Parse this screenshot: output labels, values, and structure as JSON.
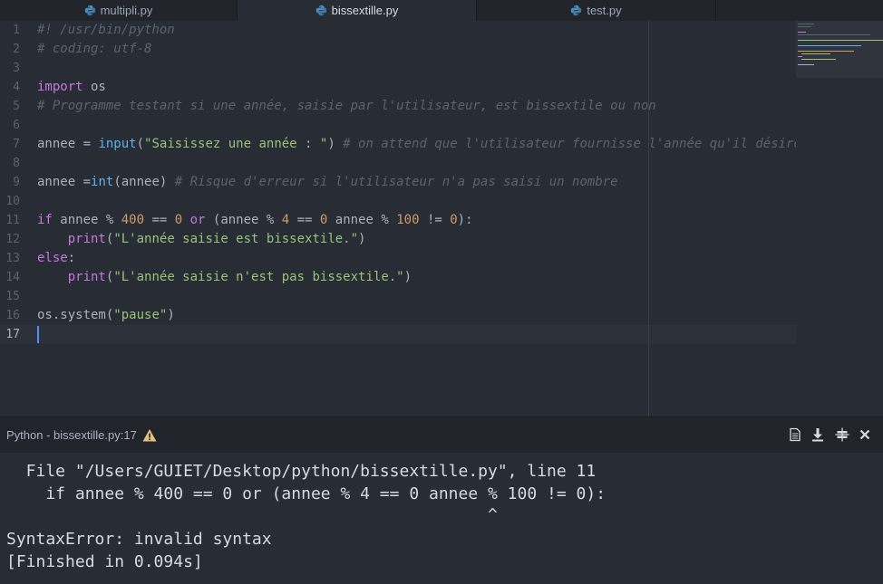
{
  "tabs": [
    {
      "label": "multipli.py",
      "active": false
    },
    {
      "label": "bissextille.py",
      "active": true
    },
    {
      "label": "test.py",
      "active": false
    }
  ],
  "editor": {
    "line_numbers": [
      "1",
      "2",
      "3",
      "4",
      "5",
      "6",
      "7",
      "8",
      "9",
      "10",
      "11",
      "12",
      "13",
      "14",
      "15",
      "16",
      "17"
    ],
    "current_line": 17
  },
  "code": {
    "l1": "#! /usr/bin/python",
    "l2": "# coding: utf-8",
    "l4_kw": "import",
    "l4_rest": " os",
    "l5": "# Programme testant si une année, saisie par l'utilisateur, est bissextile ou non",
    "l7_a": "annee = ",
    "l7_fn": "input",
    "l7_b": "(",
    "l7_str": "\"Saisissez une année : \"",
    "l7_c": ") ",
    "l7_cm": "# on attend que l'utilisateur fournisse l'année qu'il désire tester",
    "l9_a": "annee =",
    "l9_fn": "int",
    "l9_b": "(annee) ",
    "l9_cm": "# Risque d'erreur si l'utilisateur n'a pas saisi un nombre",
    "l11_if": "if",
    "l11_a": " annee % ",
    "l11_n1": "400",
    "l11_b": " == ",
    "l11_n2": "0",
    "l11_c": " ",
    "l11_or": "or",
    "l11_d": " (annee % ",
    "l11_n3": "4",
    "l11_e": " == ",
    "l11_n4": "0",
    "l11_f": " annee % ",
    "l11_n5": "100",
    "l11_g": " != ",
    "l11_n6": "0",
    "l11_h": "):",
    "l12_indent": "    ",
    "l12_fn": "print",
    "l12_a": "(",
    "l12_str": "\"L'année saisie est bissextile.\"",
    "l12_b": ")",
    "l13_kw": "else",
    "l13_a": ":",
    "l14_indent": "    ",
    "l14_fn": "print",
    "l14_a": "(",
    "l14_str": "\"L'année saisie n'est pas bissextile.\"",
    "l14_b": ")",
    "l16_a": "os.system(",
    "l16_str": "\"pause\"",
    "l16_b": ")"
  },
  "panel": {
    "title": "Python - bissextille.py:17",
    "warning_icon": "warning-icon",
    "buttons": [
      "document-icon",
      "download-icon",
      "pin-icon",
      "close-icon"
    ]
  },
  "output": {
    "line1": "  File \"/Users/GUIET/Desktop/python/bissextille.py\", line 11",
    "line2": "    if annee % 400 == 0 or (annee % 4 == 0 annee % 100 != 0):",
    "line3": "                                                 ^",
    "line4": "SyntaxError: invalid syntax",
    "line5": "[Finished in 0.094s]"
  },
  "colors": {
    "background": "#282c34",
    "keyword": "#c678dd",
    "function": "#61afef",
    "string": "#98c379",
    "number": "#d19a66",
    "comment": "#5c6370",
    "warning": "#e5c07b",
    "caret": "#528bff"
  }
}
